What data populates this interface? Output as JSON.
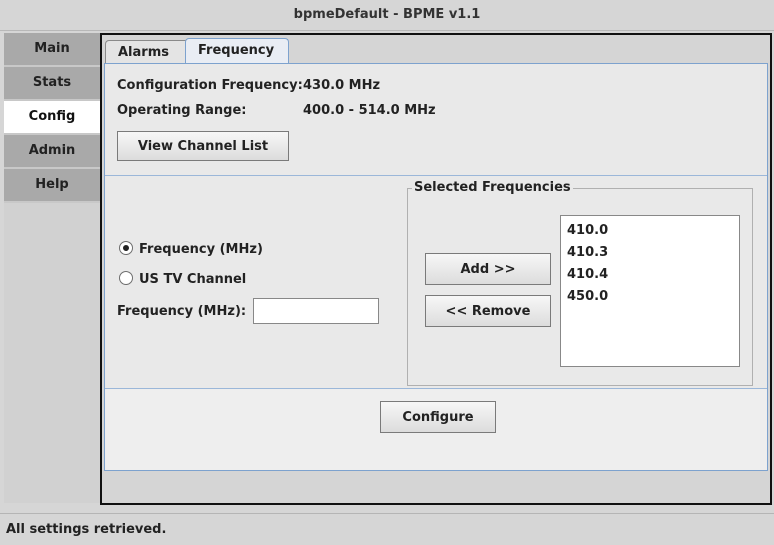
{
  "window": {
    "title": "bpmeDefault - BPME v1.1"
  },
  "nav": {
    "items": [
      {
        "label": "Main"
      },
      {
        "label": "Stats"
      },
      {
        "label": "Config"
      },
      {
        "label": "Admin"
      },
      {
        "label": "Help"
      }
    ],
    "active": "Config"
  },
  "tabs": [
    {
      "label": "Alarms"
    },
    {
      "label": "Frequency"
    }
  ],
  "frequency": {
    "config_label": "Configuration Frequency:",
    "config_value": "430.0 MHz",
    "range_label": "Operating Range:",
    "range_value": "400.0 - 514.0 MHz",
    "view_channel_button": "View Channel List",
    "radio_frequency": "Frequency (MHz)",
    "radio_tv": "US TV Channel",
    "selected_radio": "frequency",
    "input_label": "Frequency (MHz):",
    "input_value": "",
    "selected_legend": "Selected Frequencies",
    "add_button": "Add >>",
    "remove_button": "<< Remove",
    "selected_items": [
      "410.0",
      "410.3",
      "410.4",
      "450.0"
    ],
    "configure_button": "Configure"
  },
  "status": {
    "text": "All settings retrieved."
  }
}
